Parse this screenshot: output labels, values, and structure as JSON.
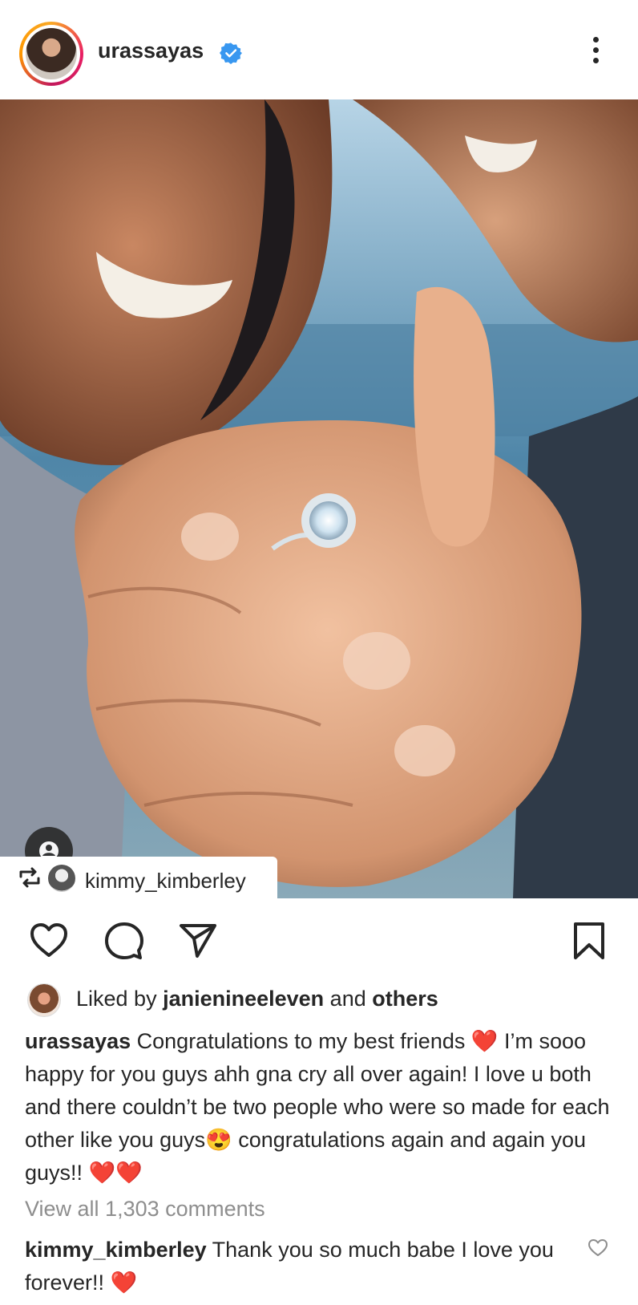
{
  "post": {
    "username": "urassayas",
    "verified": true,
    "repost_from": "kimmy_kimberley",
    "liked_by_prefix": "Liked by ",
    "liked_by_user": "janienineeleven",
    "liked_by_and": " and ",
    "liked_by_others": "others",
    "caption_username": "urassayas",
    "caption_text": "Congratulations to my best friends ❤️ I’m sooo happy for you guys ahh gna cry all over again! I love u both and there couldn’t be two people who were so made for each other like you guys😍 congratulations again and again you guys!! ❤️❤️",
    "view_all_comments": "View all 1,303 comments",
    "comment": {
      "username": "kimmy_kimberley",
      "text": "Thank you so much babe I love you forever!! ❤️"
    }
  },
  "icons": {
    "more": "more-vertical-icon",
    "verified": "verified-badge-icon",
    "like": "heart-outline-icon",
    "comment": "comment-bubble-icon",
    "share": "paper-plane-icon",
    "save": "bookmark-icon",
    "user_tag": "person-tag-icon",
    "repost": "repost-icon"
  },
  "colors": {
    "text": "#262626",
    "muted": "#8e8e8e",
    "verified_blue": "#3897f0",
    "heart_red": "#e0192d"
  }
}
